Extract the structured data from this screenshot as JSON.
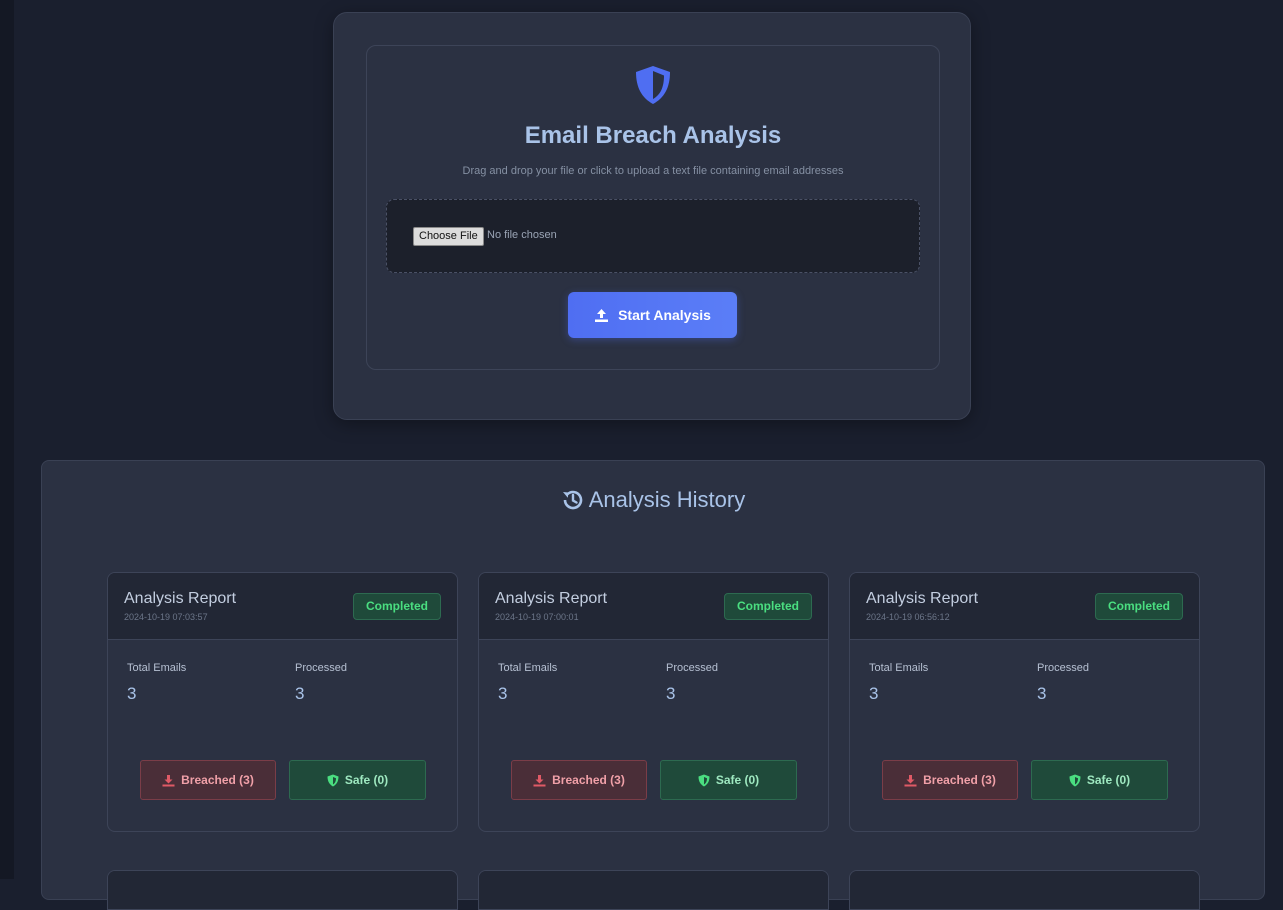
{
  "upload": {
    "title": "Email Breach Analysis",
    "subtitle": "Drag and drop your file or click to upload a text file containing email addresses",
    "choose_file_label": "Choose File",
    "file_status": "No file chosen",
    "start_button_label": "Start Analysis"
  },
  "history": {
    "title": "Analysis History",
    "reports": [
      {
        "title": "Analysis Report",
        "date": "2024-10-19 07:03:57",
        "status": "Completed",
        "total_label": "Total Emails",
        "total_value": "3",
        "processed_label": "Processed",
        "processed_value": "3",
        "breached_label": "Breached (3)",
        "safe_label": "Safe (0)"
      },
      {
        "title": "Analysis Report",
        "date": "2024-10-19 07:00:01",
        "status": "Completed",
        "total_label": "Total Emails",
        "total_value": "3",
        "processed_label": "Processed",
        "processed_value": "3",
        "breached_label": "Breached (3)",
        "safe_label": "Safe (0)"
      },
      {
        "title": "Analysis Report",
        "date": "2024-10-19 06:56:12",
        "status": "Completed",
        "total_label": "Total Emails",
        "total_value": "3",
        "processed_label": "Processed",
        "processed_value": "3",
        "breached_label": "Breached (3)",
        "safe_label": "Safe (0)"
      }
    ]
  },
  "icons": {
    "shield": "shield-icon",
    "upload": "upload-icon",
    "history": "history-icon",
    "download": "download-icon",
    "shield_check": "shield-check-icon"
  },
  "colors": {
    "accent": "#4f6ef2",
    "completed": "#4ade80",
    "breached": "#e05a66",
    "safe": "#4ade80",
    "heading": "#a9c3e8"
  }
}
